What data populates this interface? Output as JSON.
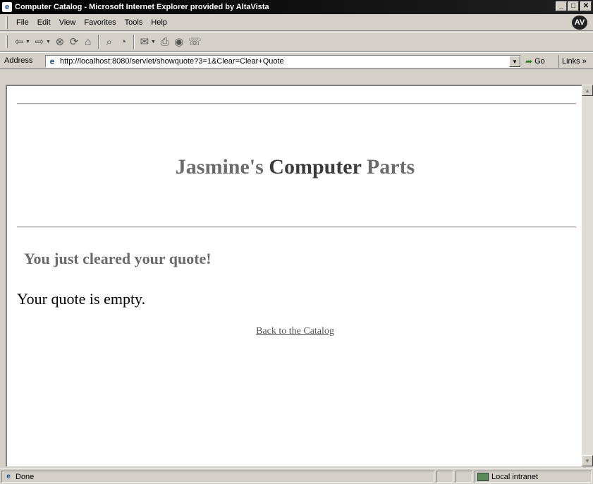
{
  "window": {
    "title": "Computer Catalog - Microsoft Internet Explorer provided by AltaVista",
    "min_glyph": "_",
    "max_glyph": "□",
    "close_glyph": "✕"
  },
  "menubar": {
    "items": [
      "File",
      "Edit",
      "View",
      "Favorites",
      "Tools",
      "Help"
    ],
    "brand_logo": "AV"
  },
  "toolbar": {
    "buttons": [
      {
        "name": "back-icon",
        "glyph": "⇦"
      },
      {
        "name": "forward-icon",
        "glyph": "⇨"
      },
      {
        "name": "stop-icon",
        "glyph": "⊗"
      },
      {
        "name": "refresh-icon",
        "glyph": "⟳"
      },
      {
        "name": "home-icon",
        "glyph": "⌂"
      },
      {
        "name": "search-icon",
        "glyph": "⌕"
      },
      {
        "name": "history-icon",
        "glyph": "◔"
      },
      {
        "name": "mail-icon",
        "glyph": "✉"
      },
      {
        "name": "print-icon",
        "glyph": "⎙"
      },
      {
        "name": "altavista-icon",
        "glyph": "◉"
      },
      {
        "name": "discuss-icon",
        "glyph": "☏"
      }
    ]
  },
  "address": {
    "label": "Address",
    "url": "http://localhost:8080/servlet/showquote?3=1&Clear=Clear+Quote",
    "go_label": "Go",
    "links_label": "Links »"
  },
  "page": {
    "title_part1": "Jasmine's ",
    "title_part2": "Computer",
    "title_part3": " Parts",
    "heading": "You just cleared your quote!",
    "message": "Your quote is empty.",
    "back_link": "Back to the Catalog"
  },
  "status": {
    "text": "Done",
    "zone": "Local intranet"
  }
}
